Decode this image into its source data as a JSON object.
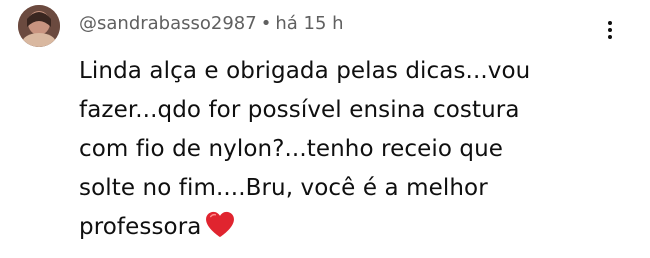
{
  "comment": {
    "author": "@sandrabasso2987",
    "separator": "•",
    "time": "há 15 h",
    "lines": [
      "Linda alça e obrigada pelas dicas...vou",
      "fazer...qdo for possível ensina costura",
      "com fio de nylon?...tenho receio que",
      "solte no fim....Bru,  você é a melhor",
      "professora"
    ],
    "emoji": "red-heart-emoji",
    "menu_icon": "more-vertical-icon",
    "heart_color": "#e0242f"
  }
}
